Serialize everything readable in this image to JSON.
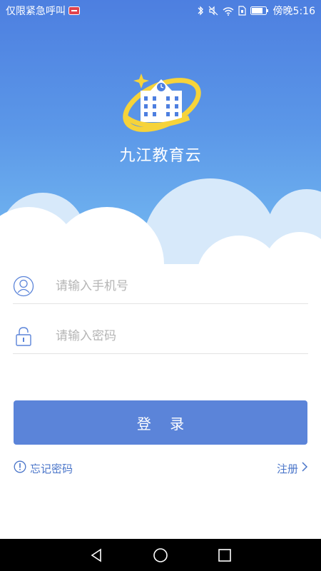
{
  "status_bar": {
    "left_text": "仅限紧急呼叫",
    "time": "傍晚5:16",
    "icons": [
      "sim-blocked-icon",
      "bluetooth-icon",
      "mute-icon",
      "wifi-icon",
      "sim-icon",
      "battery-icon"
    ]
  },
  "app": {
    "name": "九江教育云",
    "logo_icon": "school-building-icon"
  },
  "form": {
    "phone_placeholder": "请输入手机号",
    "password_placeholder": "请输入密码",
    "phone_icon": "user-icon",
    "password_icon": "lock-icon"
  },
  "actions": {
    "login_label": "登 录",
    "forgot_label": "忘记密码",
    "register_label": "注册"
  },
  "nav": {
    "icons": [
      "back-icon",
      "home-icon",
      "recents-icon"
    ]
  },
  "colors": {
    "primary": "#5b84d9",
    "link": "#4a75c9",
    "hero_top": "#4d7fe0",
    "hero_bottom": "#7cc0f2"
  }
}
